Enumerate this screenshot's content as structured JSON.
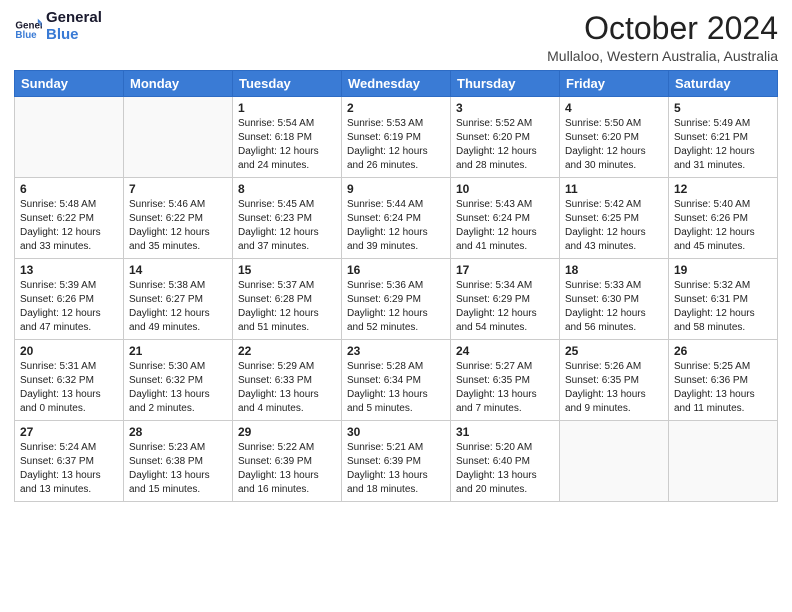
{
  "logo": {
    "line1": "General",
    "line2": "Blue"
  },
  "title": "October 2024",
  "location": "Mullaloo, Western Australia, Australia",
  "days_of_week": [
    "Sunday",
    "Monday",
    "Tuesday",
    "Wednesday",
    "Thursday",
    "Friday",
    "Saturday"
  ],
  "weeks": [
    [
      {
        "day": "",
        "info": ""
      },
      {
        "day": "",
        "info": ""
      },
      {
        "day": "1",
        "info": "Sunrise: 5:54 AM\nSunset: 6:18 PM\nDaylight: 12 hours and 24 minutes."
      },
      {
        "day": "2",
        "info": "Sunrise: 5:53 AM\nSunset: 6:19 PM\nDaylight: 12 hours and 26 minutes."
      },
      {
        "day": "3",
        "info": "Sunrise: 5:52 AM\nSunset: 6:20 PM\nDaylight: 12 hours and 28 minutes."
      },
      {
        "day": "4",
        "info": "Sunrise: 5:50 AM\nSunset: 6:20 PM\nDaylight: 12 hours and 30 minutes."
      },
      {
        "day": "5",
        "info": "Sunrise: 5:49 AM\nSunset: 6:21 PM\nDaylight: 12 hours and 31 minutes."
      }
    ],
    [
      {
        "day": "6",
        "info": "Sunrise: 5:48 AM\nSunset: 6:22 PM\nDaylight: 12 hours and 33 minutes."
      },
      {
        "day": "7",
        "info": "Sunrise: 5:46 AM\nSunset: 6:22 PM\nDaylight: 12 hours and 35 minutes."
      },
      {
        "day": "8",
        "info": "Sunrise: 5:45 AM\nSunset: 6:23 PM\nDaylight: 12 hours and 37 minutes."
      },
      {
        "day": "9",
        "info": "Sunrise: 5:44 AM\nSunset: 6:24 PM\nDaylight: 12 hours and 39 minutes."
      },
      {
        "day": "10",
        "info": "Sunrise: 5:43 AM\nSunset: 6:24 PM\nDaylight: 12 hours and 41 minutes."
      },
      {
        "day": "11",
        "info": "Sunrise: 5:42 AM\nSunset: 6:25 PM\nDaylight: 12 hours and 43 minutes."
      },
      {
        "day": "12",
        "info": "Sunrise: 5:40 AM\nSunset: 6:26 PM\nDaylight: 12 hours and 45 minutes."
      }
    ],
    [
      {
        "day": "13",
        "info": "Sunrise: 5:39 AM\nSunset: 6:26 PM\nDaylight: 12 hours and 47 minutes."
      },
      {
        "day": "14",
        "info": "Sunrise: 5:38 AM\nSunset: 6:27 PM\nDaylight: 12 hours and 49 minutes."
      },
      {
        "day": "15",
        "info": "Sunrise: 5:37 AM\nSunset: 6:28 PM\nDaylight: 12 hours and 51 minutes."
      },
      {
        "day": "16",
        "info": "Sunrise: 5:36 AM\nSunset: 6:29 PM\nDaylight: 12 hours and 52 minutes."
      },
      {
        "day": "17",
        "info": "Sunrise: 5:34 AM\nSunset: 6:29 PM\nDaylight: 12 hours and 54 minutes."
      },
      {
        "day": "18",
        "info": "Sunrise: 5:33 AM\nSunset: 6:30 PM\nDaylight: 12 hours and 56 minutes."
      },
      {
        "day": "19",
        "info": "Sunrise: 5:32 AM\nSunset: 6:31 PM\nDaylight: 12 hours and 58 minutes."
      }
    ],
    [
      {
        "day": "20",
        "info": "Sunrise: 5:31 AM\nSunset: 6:32 PM\nDaylight: 13 hours and 0 minutes."
      },
      {
        "day": "21",
        "info": "Sunrise: 5:30 AM\nSunset: 6:32 PM\nDaylight: 13 hours and 2 minutes."
      },
      {
        "day": "22",
        "info": "Sunrise: 5:29 AM\nSunset: 6:33 PM\nDaylight: 13 hours and 4 minutes."
      },
      {
        "day": "23",
        "info": "Sunrise: 5:28 AM\nSunset: 6:34 PM\nDaylight: 13 hours and 5 minutes."
      },
      {
        "day": "24",
        "info": "Sunrise: 5:27 AM\nSunset: 6:35 PM\nDaylight: 13 hours and 7 minutes."
      },
      {
        "day": "25",
        "info": "Sunrise: 5:26 AM\nSunset: 6:35 PM\nDaylight: 13 hours and 9 minutes."
      },
      {
        "day": "26",
        "info": "Sunrise: 5:25 AM\nSunset: 6:36 PM\nDaylight: 13 hours and 11 minutes."
      }
    ],
    [
      {
        "day": "27",
        "info": "Sunrise: 5:24 AM\nSunset: 6:37 PM\nDaylight: 13 hours and 13 minutes."
      },
      {
        "day": "28",
        "info": "Sunrise: 5:23 AM\nSunset: 6:38 PM\nDaylight: 13 hours and 15 minutes."
      },
      {
        "day": "29",
        "info": "Sunrise: 5:22 AM\nSunset: 6:39 PM\nDaylight: 13 hours and 16 minutes."
      },
      {
        "day": "30",
        "info": "Sunrise: 5:21 AM\nSunset: 6:39 PM\nDaylight: 13 hours and 18 minutes."
      },
      {
        "day": "31",
        "info": "Sunrise: 5:20 AM\nSunset: 6:40 PM\nDaylight: 13 hours and 20 minutes."
      },
      {
        "day": "",
        "info": ""
      },
      {
        "day": "",
        "info": ""
      }
    ]
  ]
}
